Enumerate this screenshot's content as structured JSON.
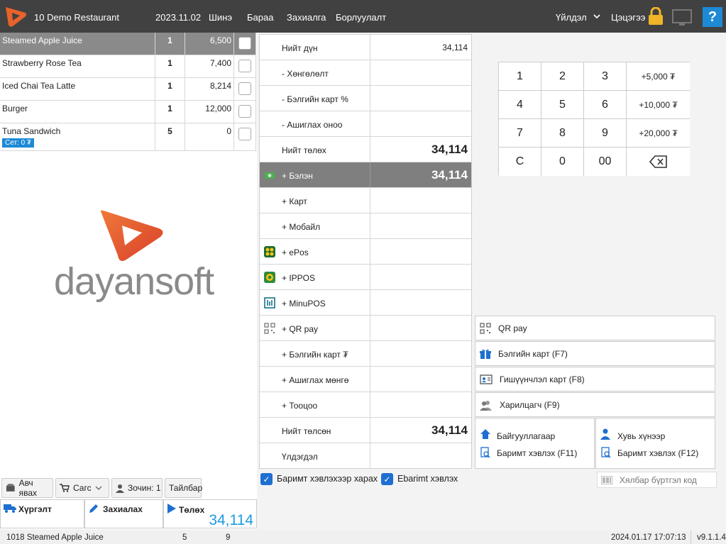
{
  "header": {
    "restaurant": "10 Demo Restaurant",
    "date": "2023.11.02",
    "menu": [
      "Шинэ",
      "Бараа",
      "Захиалга",
      "Борлуулалт"
    ],
    "actions_label": "Үйлдэл",
    "user": "Цэцэгээ"
  },
  "order": {
    "items": [
      {
        "name": "Steamed Apple Juice",
        "qty": "1",
        "price": "6,500"
      },
      {
        "name": "Strawberry Rose Tea",
        "qty": "1",
        "price": "7,400"
      },
      {
        "name": "Iced Chai Tea Latte",
        "qty": "1",
        "price": "8,214"
      },
      {
        "name": "Burger",
        "qty": "1",
        "price": "12,000"
      },
      {
        "name": "Tuna Sandwich",
        "qty": "5",
        "price": "0",
        "badge": "Сет: 0 ₮"
      }
    ]
  },
  "brand": {
    "name": "dayansoft"
  },
  "left_buttons": {
    "takeaway": "Авч явах",
    "cart": "Сагс",
    "guests": "Зочин: 1",
    "note": "Тайлбар"
  },
  "bottom_tiles": {
    "delivery": "Хүргэлт",
    "order": "Захиалах",
    "pay": "Төлөх",
    "pay_amount": "34,114"
  },
  "payment": {
    "rows": [
      {
        "label": "Нийт дүн",
        "value": "34,114"
      },
      {
        "label": "- Хөнгөлөлт",
        "value": ""
      },
      {
        "label": "- Бэлгийн карт %",
        "value": ""
      },
      {
        "label": "- Ашиглах оноо",
        "value": ""
      },
      {
        "label": "Нийт төлөх",
        "value": "34,114"
      },
      {
        "label": "+ Бэлэн",
        "value": "34,114"
      },
      {
        "label": "+ Карт",
        "value": ""
      },
      {
        "label": "+ Мобайл",
        "value": ""
      },
      {
        "label": "+ ePos",
        "value": ""
      },
      {
        "label": "+ IPPOS",
        "value": ""
      },
      {
        "label": "+ MinuPOS",
        "value": ""
      },
      {
        "label": "+ QR pay",
        "value": ""
      },
      {
        "label": "+ Бэлгийн карт ₮",
        "value": ""
      },
      {
        "label": "+ Ашиглах мөнгө",
        "value": ""
      },
      {
        "label": "+ Тооцоо",
        "value": ""
      },
      {
        "label": "Нийт төлсөн",
        "value": "34,114"
      },
      {
        "label": "Үлдэгдэл",
        "value": ""
      }
    ]
  },
  "numpad": {
    "keys": [
      "1",
      "2",
      "3",
      "+5,000 ₮",
      "4",
      "5",
      "6",
      "+10,000 ₮",
      "7",
      "8",
      "9",
      "+20,000 ₮",
      "C",
      "0",
      "00",
      ""
    ]
  },
  "right_buttons": {
    "qr": "QR pay",
    "gift": "Бэлгийн карт (F7)",
    "member": "Гишүүнчлэл карт (F8)",
    "customer": "Харилцагч (F9)",
    "org": "Байгууллагаар",
    "org_print": "Баримт хэвлэх (F11)",
    "person": "Хувь хүнээр",
    "person_print": "Баримт хэвлэх (F12)"
  },
  "checkboxes": {
    "preview": "Баримт хэвлэхээр харах",
    "ebarimt": "Ebarimt хэвлэх"
  },
  "barcode": {
    "placeholder": "Хялбар бүртгэл код"
  },
  "status": {
    "item": "1018 Steamed Apple Juice",
    "a": "5",
    "b": "9",
    "datetime": "2024.01.17 17:07:13",
    "version": "v9.1.1.4"
  },
  "colors": {
    "topbar": "#414141",
    "accent": "#1e8ad6",
    "selected_row": "#8a8a8a",
    "brand_orange": "#e8622c"
  }
}
